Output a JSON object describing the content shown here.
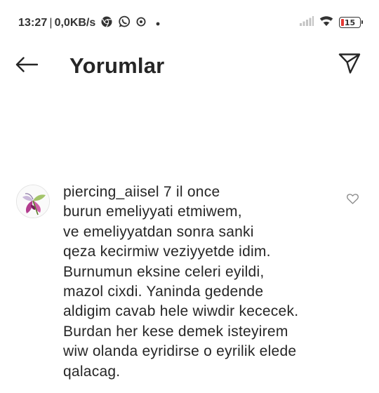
{
  "status_bar": {
    "time": "13:27",
    "separator": "|",
    "network_speed": "0,0KB/s",
    "battery_level": "15",
    "battery_percent": 15,
    "icons": [
      "chrome-icon",
      "whatsapp-icon",
      "sync-icon",
      "dot-icon",
      "signal-icon",
      "wifi-icon",
      "battery-icon"
    ]
  },
  "header": {
    "title": "Yorumlar",
    "back_icon": "arrow-left-icon",
    "send_icon": "paper-plane-icon"
  },
  "comment": {
    "username": "piercing_aiisel",
    "time": "7 il once",
    "lines": [
      "burun emeliyyati etmiwem,",
      "ve emeliyyatdan sonra sanki",
      "qeza kecirmiw veziyyetde idim.",
      "Burnumun eksine celeri eyildi,",
      "mazol cixdi. Yaninda gedende",
      "aldigim cavab hele wiwdir kececek.",
      "Burdan her kese demek isteyirem",
      "wiw olanda eyridirse o eyrilik elede",
      "qalacag."
    ],
    "like_icon": "heart-outline-icon"
  },
  "colors": {
    "text": "#262626",
    "background": "#ffffff",
    "battery_low": "#e53935"
  }
}
